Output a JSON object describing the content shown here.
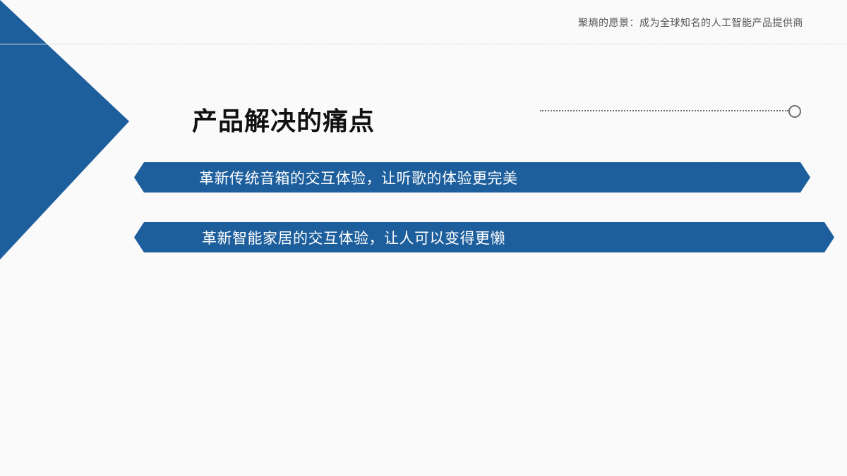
{
  "header": {
    "tagline": "聚熵的愿景：成为全球知名的人工智能产品提供商"
  },
  "main": {
    "title": "产品解决的痛点",
    "points": [
      {
        "text": "革新传统音箱的交互体验，让听歌的体验更完美"
      },
      {
        "text": "革新智能家居的交互体验，让人可以变得更懒"
      }
    ]
  },
  "colors": {
    "accent": "#1d5e9c",
    "title_text": "#111111",
    "tagline_text": "#555555",
    "decor_gray": "#6f6f74"
  }
}
